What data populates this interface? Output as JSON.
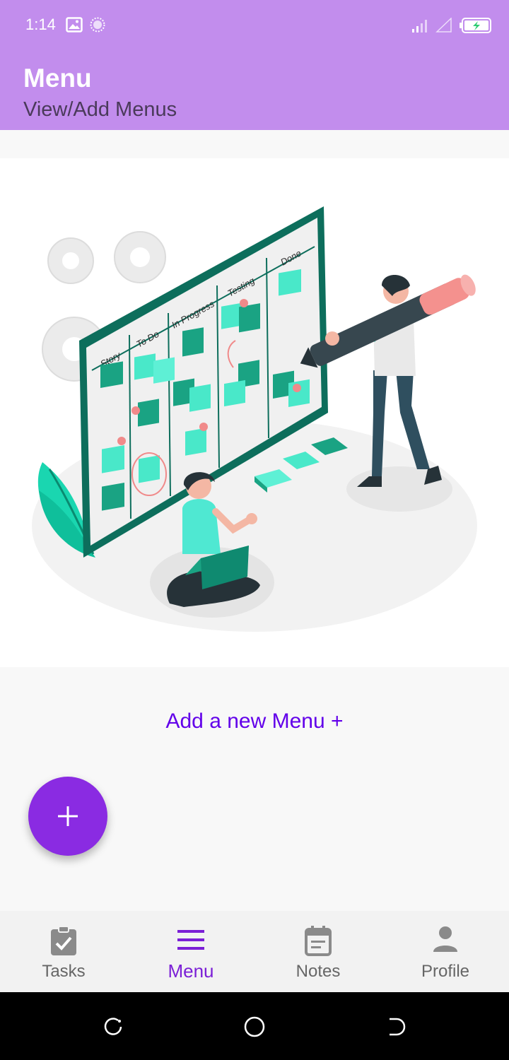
{
  "status_bar": {
    "time": "1:14",
    "icons": [
      "image-icon",
      "sync-icon",
      "signal-icon",
      "no-signal-icon",
      "battery-charging-icon"
    ]
  },
  "header": {
    "title": "Menu",
    "subtitle": "View/Add Menus",
    "background": "#c28ded"
  },
  "illustration": {
    "board_columns": [
      "Story",
      "To Do",
      "In Progress",
      "Testing",
      "Done"
    ]
  },
  "main": {
    "add_link": "Add a new Menu +",
    "accent": "#6200ea"
  },
  "fab": {
    "icon": "plus-icon",
    "color": "#8a2be2"
  },
  "bottom_nav": {
    "items": [
      {
        "label": "Tasks",
        "icon": "clipboard-check-icon"
      },
      {
        "label": "Menu",
        "icon": "menu-icon",
        "active": true
      },
      {
        "label": "Notes",
        "icon": "calendar-note-icon"
      },
      {
        "label": "Profile",
        "icon": "person-icon"
      }
    ],
    "active_color": "#7b1fd6"
  },
  "system_nav": {
    "icons": [
      "recent-apps-icon",
      "home-icon",
      "back-icon"
    ]
  }
}
